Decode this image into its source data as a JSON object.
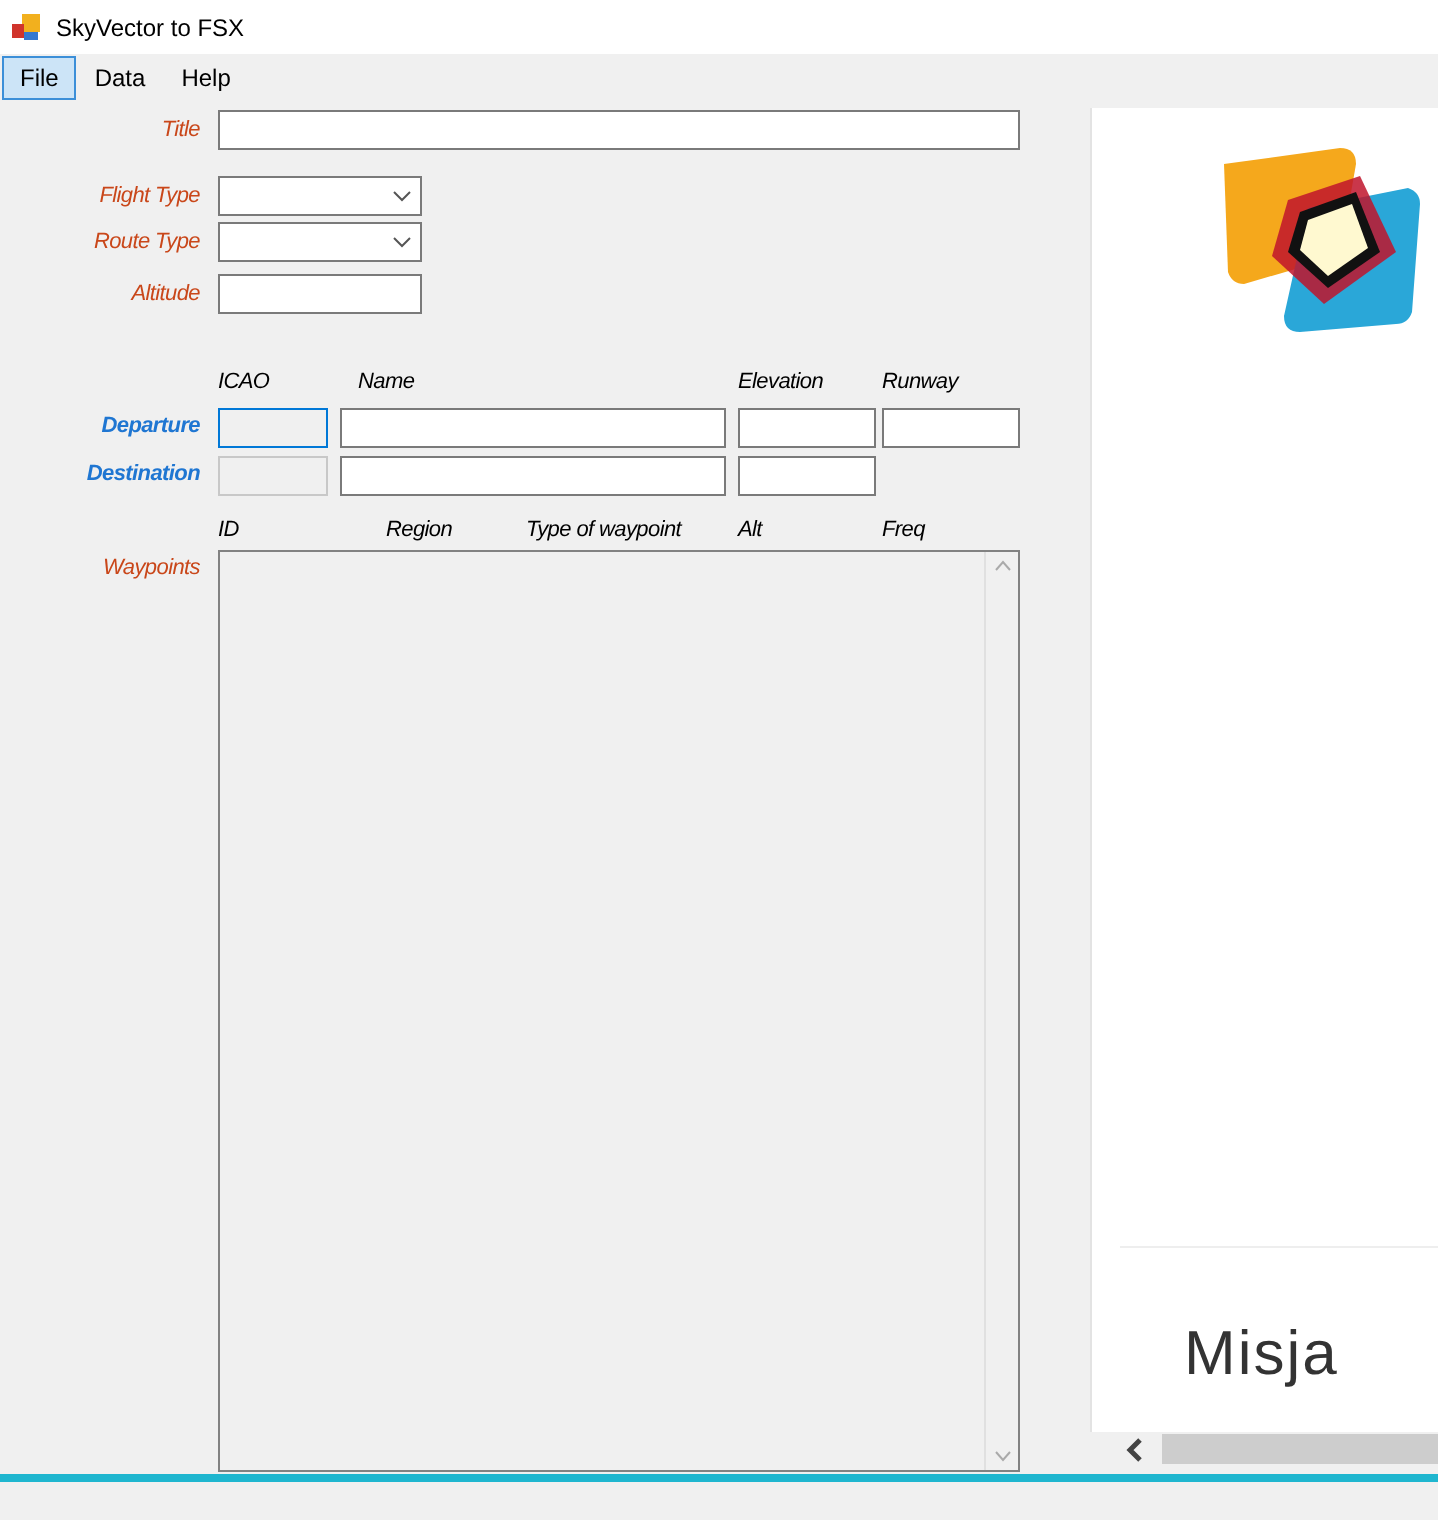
{
  "window": {
    "title": "SkyVector to FSX"
  },
  "menu": [
    {
      "label": "File",
      "selected": true
    },
    {
      "label": "Data",
      "selected": false
    },
    {
      "label": "Help",
      "selected": false
    }
  ],
  "fields": [
    {
      "label": "Title",
      "kind": "text"
    },
    {
      "label": "Flight Type",
      "kind": "combo"
    },
    {
      "label": "Route Type",
      "kind": "combo"
    },
    {
      "label": "Altitude",
      "kind": "short"
    }
  ],
  "airports": {
    "columns": [
      "ICAO",
      "Name",
      "Elevation",
      "Runway"
    ],
    "rows": [
      {
        "label": "Departure",
        "has_runway": true,
        "focused": true
      },
      {
        "label": "Destination",
        "has_runway": false,
        "focused": false
      }
    ]
  },
  "waypoints": {
    "label": "Waypoints",
    "columns": [
      "ID",
      "Region",
      "Type of waypoint",
      "Alt",
      "Freq"
    ]
  },
  "browser": {
    "heading": "Misja"
  }
}
